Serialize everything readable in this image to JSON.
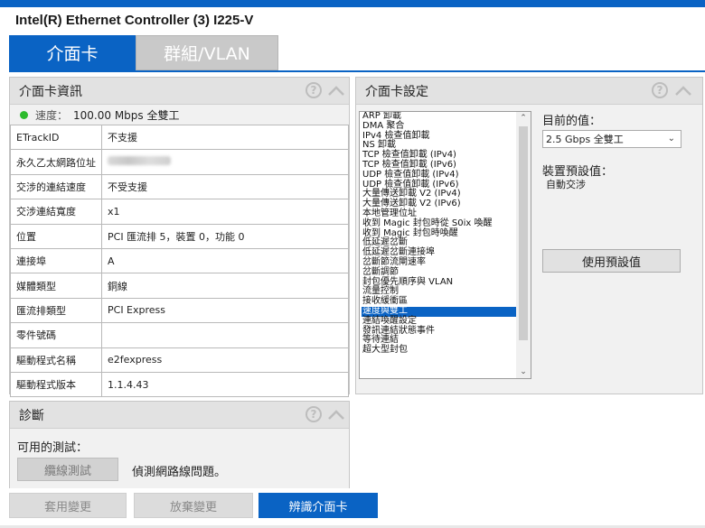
{
  "app": {
    "title": "Intel(R) Ethernet Controller (3) I225-V"
  },
  "tabs": [
    {
      "label": "介面卡"
    },
    {
      "label": "群組/VLAN"
    }
  ],
  "info_panel": {
    "title": "介面卡資訊",
    "speed_label": "速度：",
    "speed_value": "100.00 Mbps 全雙工",
    "status_color": "#2dbb2d",
    "rows": [
      {
        "key": "ETrackID",
        "value": "不支援"
      },
      {
        "key": "永久乙太網路位址",
        "value": ""
      },
      {
        "key": "交涉的連結速度",
        "value": "不受支援"
      },
      {
        "key": "交涉連結寬度",
        "value": "x1"
      },
      {
        "key": "位置",
        "value": "PCI 匯流排 5，裝置 0，功能 0"
      },
      {
        "key": "連接埠",
        "value": "A"
      },
      {
        "key": "媒體類型",
        "value": "銅線"
      },
      {
        "key": "匯流排類型",
        "value": "PCI Express"
      },
      {
        "key": "零件號碼",
        "value": ""
      },
      {
        "key": "驅動程式名稱",
        "value": "e2fexpress"
      },
      {
        "key": "驅動程式版本",
        "value": "1.1.4.43"
      }
    ]
  },
  "settings_panel": {
    "title": "介面卡設定",
    "list": [
      "ARP 卸載",
      "DMA 聚合",
      "IPv4 檢查值卸載",
      "NS 卸載",
      "TCP 檢查值卸載 (IPv4)",
      "TCP 檢查值卸載 (IPv6)",
      "UDP 檢查值卸載 (IPv4)",
      "UDP 檢查值卸載 (IPv6)",
      "大量傳送卸載 V2 (IPv4)",
      "大量傳送卸載 V2 (IPv6)",
      "本地管理位址",
      "收到 Magic 封包時從 S0ix 喚醒",
      "收到 Magic 封包時喚醒",
      "低延遲岔斷",
      "低延遲岔斷連接埠",
      "岔斷節流閘速率",
      "岔斷調節",
      "封包優先順序與 VLAN",
      "流量控制",
      "接收緩衝區",
      "速度與雙工",
      "連結喚醒設定",
      "發訊連結狀態事件",
      "等待連結",
      "超大型封包"
    ],
    "selected_index": 20,
    "current_value_label": "目前的值：",
    "current_value": "2.5 Gbps 全雙工",
    "default_label": "裝置預設值：",
    "default_value": "自動交涉",
    "use_default_button": "使用預設值"
  },
  "diag_panel": {
    "title": "診斷",
    "available_tests_label": "可用的測試：",
    "cable_test_button": "纜線測試",
    "cable_test_desc": "偵測網路線問題。"
  },
  "bottom_bar": {
    "apply": "套用變更",
    "discard": "放棄變更",
    "identify": "辨識介面卡"
  },
  "colors": {
    "accent": "#0a63c4"
  }
}
